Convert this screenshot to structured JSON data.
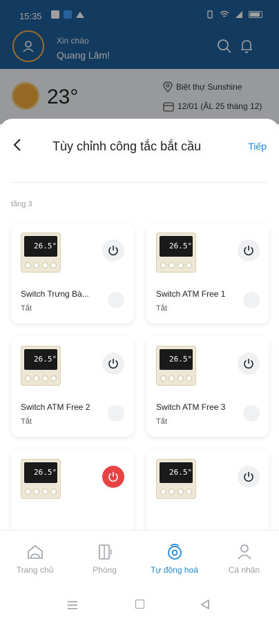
{
  "status_bar": {
    "time": "15:35"
  },
  "header": {
    "greeting": "Xin chào",
    "username": "Quang Lâm!",
    "icons": [
      "user-icon",
      "search-icon",
      "bell-icon"
    ]
  },
  "weather": {
    "temperature": "23°",
    "location": "Biệt thự Sunshine",
    "date": "12/01 (ÂL 25 tháng 12)"
  },
  "sheet": {
    "title": "Tùy chỉnh công tắc bắt cầu",
    "next_label": "Tiếp",
    "section_label": "tầng 3"
  },
  "devices": [
    {
      "name": "Switch Trưng Bà...",
      "state": "Tắt",
      "screen": "26.5°"
    },
    {
      "name": "Switch ATM Free 1",
      "state": "Tắt",
      "screen": "26.5°"
    },
    {
      "name": "Switch ATM Free 2",
      "state": "Tắt",
      "screen": "26.5°"
    },
    {
      "name": "Switch ATM Free 3",
      "state": "Tắt",
      "screen": "26.5°"
    },
    {
      "name": "",
      "state": "",
      "screen": "26.5°",
      "alert": true
    },
    {
      "name": "",
      "state": "",
      "screen": "26.5°"
    }
  ],
  "bottom_nav": [
    {
      "label": "Trang chủ",
      "icon": "home-icon"
    },
    {
      "label": "Phòng",
      "icon": "door-icon"
    },
    {
      "label": "Tự động hoá",
      "icon": "automation-icon",
      "active": true
    },
    {
      "label": "Cá nhân",
      "icon": "person-icon"
    }
  ],
  "colors": {
    "primary": "#1f5f9c",
    "accent": "#1e88d6",
    "alert": "#e84343"
  }
}
